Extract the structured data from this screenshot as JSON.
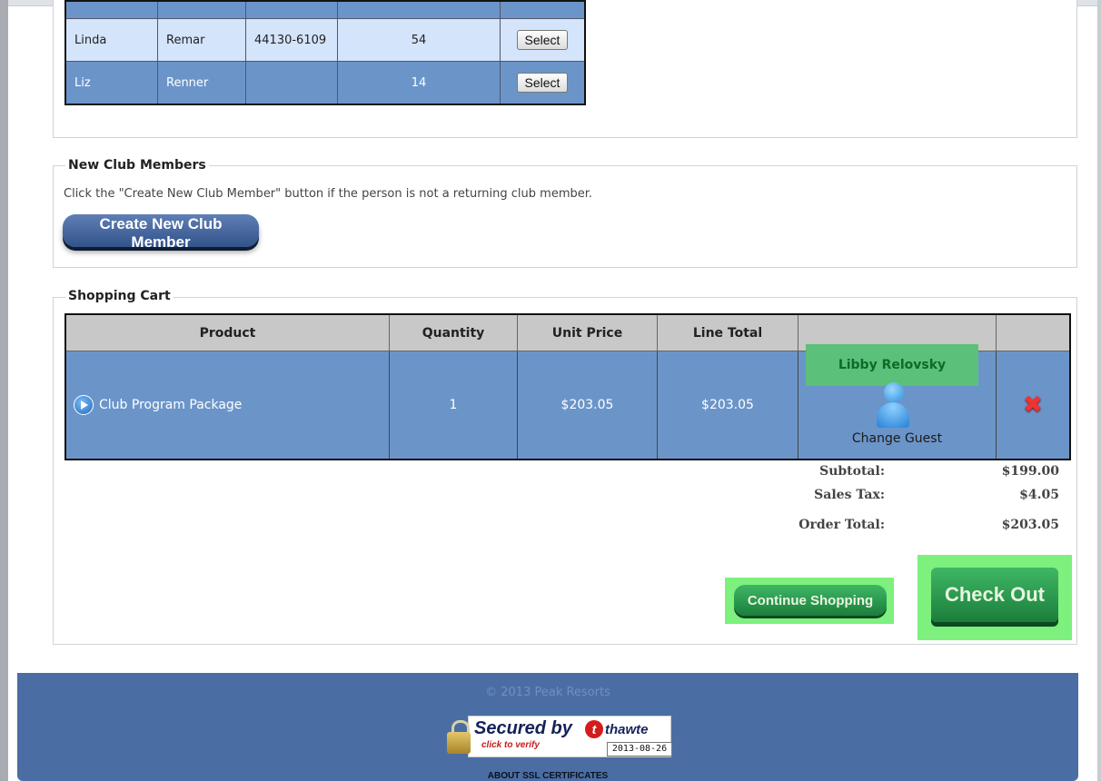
{
  "members": {
    "rows": [
      {
        "first": "Linda",
        "last": "Remar",
        "zip": "44130-6109",
        "age": "54",
        "action": "Select",
        "style": "light"
      },
      {
        "first": "Liz",
        "last": "Renner",
        "zip": "",
        "age": "14",
        "action": "Select",
        "style": "dark"
      }
    ]
  },
  "new_members": {
    "legend": "New Club Members",
    "description": "Click the \"Create New Club Member\" button if the person is not a returning club member.",
    "button_label": "Create New Club Member"
  },
  "cart": {
    "legend": "Shopping Cart",
    "headers": [
      "Product",
      "Quantity",
      "Unit Price",
      "Line Total",
      "",
      ""
    ],
    "items": [
      {
        "product": "Club Program Package",
        "quantity": "1",
        "unit_price": "$203.05",
        "line_total": "$203.05",
        "guest_name": "Libby Relovsky",
        "change_guest": "Change Guest",
        "icon": "person-icon",
        "remove_icon": "remove-x-icon"
      }
    ],
    "subtotal_label": "Subtotal:",
    "subtotal": "$199.00",
    "tax_label": "Sales Tax:",
    "tax": "$4.05",
    "total_label": "Order Total:",
    "total": "$203.05",
    "continue_label": "Continue Shopping",
    "checkout_label": "Check Out"
  },
  "footer": {
    "copyright": "© 2013 Peak Resorts",
    "seal_text": "Secured by",
    "seal_brand": "thawte",
    "seal_click": "click to verify",
    "seal_date": "2013-08-26",
    "about_ssl": "ABOUT SSL CERTIFICATES"
  },
  "colors": {
    "row_light": "#d3e4fb",
    "row_dark": "#6b95c9",
    "highlight_green": "#7df07d",
    "footer_bg": "#4a6ea3"
  }
}
